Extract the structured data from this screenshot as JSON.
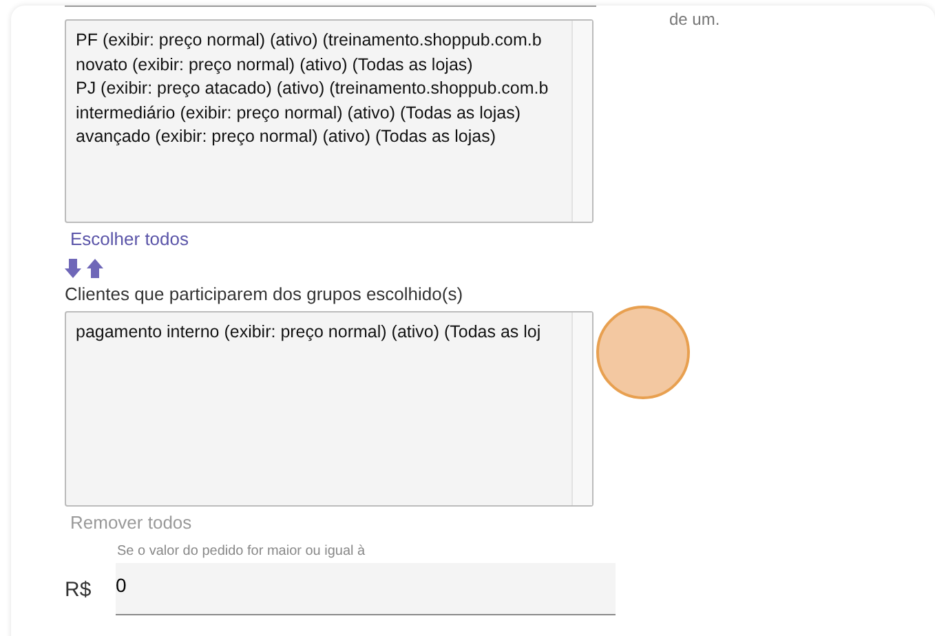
{
  "side_note": "de um.",
  "available_groups": {
    "items": [
      {
        "label": "PF (exibir: preço normal) (ativo) (treinamento.shoppub.com.b"
      },
      {
        "label": "novato (exibir: preço normal) (ativo) (Todas as lojas)"
      },
      {
        "label": "PJ (exibir: preço atacado) (ativo) (treinamento.shoppub.com.b"
      },
      {
        "label": "intermediário (exibir: preço normal) (ativo) (Todas as lojas)"
      },
      {
        "label": "avançado (exibir: preço normal) (ativo) (Todas as lojas)"
      }
    ],
    "action": {
      "label": "Escolher todos",
      "disabled": false
    }
  },
  "chosen_label": "Clientes que participarem dos grupos escolhido(s)",
  "chosen_groups": {
    "items": [
      {
        "label": "pagamento interno (exibir: preço normal) (ativo) (Todas as loj"
      }
    ],
    "action": {
      "label": "Remover todos",
      "disabled": true
    }
  },
  "order_value": {
    "hint": "Se o valor do pedido for maior ou igual à",
    "currency": "R$",
    "value": "0"
  }
}
